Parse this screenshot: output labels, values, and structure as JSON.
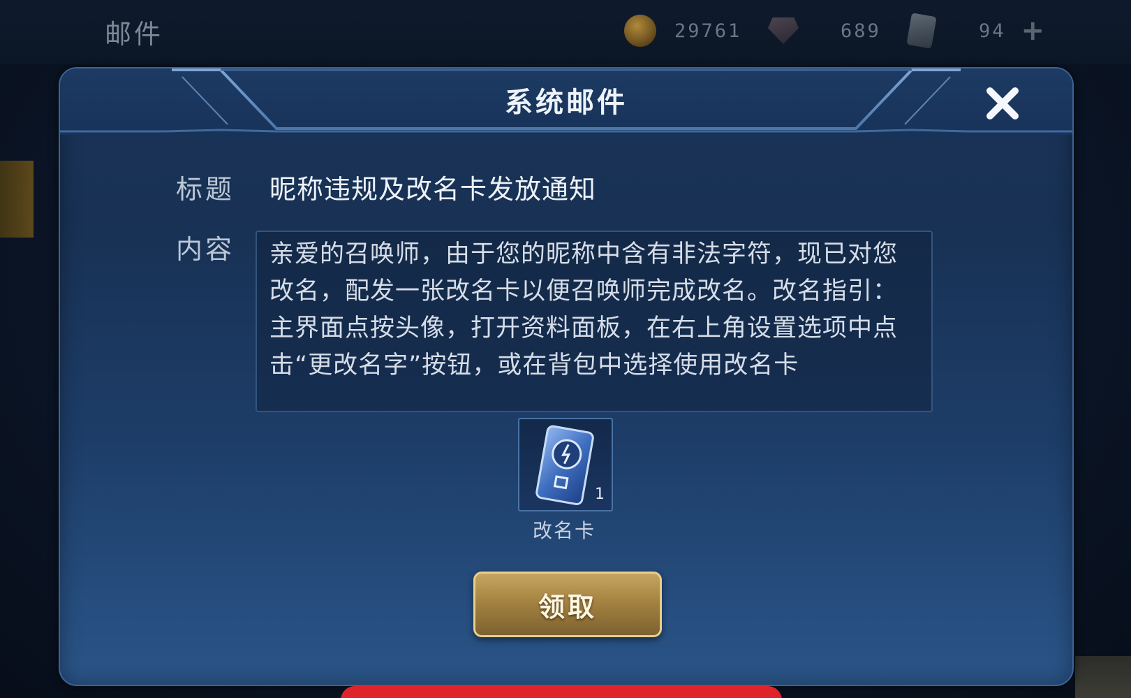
{
  "topbar": {
    "page_title": "邮件",
    "gold": "29761",
    "diamonds": "689",
    "vouchers": "94",
    "icons": [
      "gold-coin-icon",
      "diamond-icon",
      "voucher-icon",
      "plus-icon"
    ]
  },
  "dialog": {
    "title": "系统邮件",
    "subject_label": "标题",
    "subject_value": "昵称违规及改名卡发放通知",
    "content_label": "内容",
    "content_text": "亲爱的召唤师，由于您的昵称中含有非法字符，现已对您改名，配发一张改名卡以便召唤师完成改名。改名指引：主界面点按头像，打开资料面板，在右上角设置选项中点击“更改名字”按钮，或在背包中选择使用改名卡",
    "attachment": {
      "name": "改名卡",
      "count": "1",
      "icon": "rename-card-icon"
    },
    "claim_button": "领取",
    "close_icon": "close-icon"
  },
  "colors": {
    "dialog_bg": "#1d3d68",
    "gold_button": "#a1803f",
    "banner_red": "#e0232b"
  }
}
